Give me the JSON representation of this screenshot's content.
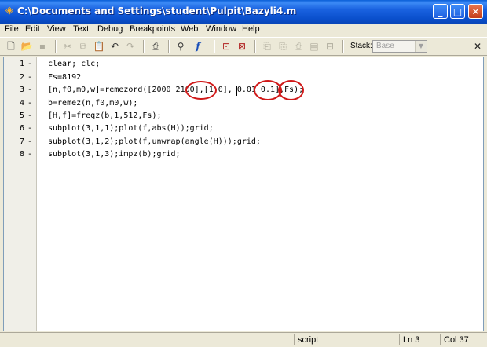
{
  "window": {
    "title": "C:\\Documents and Settings\\student\\Pulpit\\Bazyli4.m",
    "app_icon": "matlab-logo-icon",
    "minimize_glyph": "_",
    "maximize_glyph": "□",
    "close_glyph": "✕"
  },
  "menu": [
    "File",
    "Edit",
    "View",
    "Text",
    "Debug",
    "Breakpoints",
    "Web",
    "Window",
    "Help"
  ],
  "toolbar": {
    "icons": [
      "new-file-icon",
      "open-folder-icon",
      "save-icon",
      "cut-icon",
      "copy-icon",
      "paste-icon",
      "undo-icon",
      "redo-icon",
      "print-icon",
      "find-binoculars-icon",
      "function-icon",
      "set-breakpoint-icon",
      "clear-breakpoints-icon",
      "step-icon",
      "step-in-icon",
      "step-out-icon",
      "continue-icon",
      "exit-debug-icon"
    ],
    "stack_label": "Stack:",
    "stack_value": "Base",
    "doc_close_glyph": "✕"
  },
  "editor": {
    "lines": [
      {
        "num": "1",
        "text": "clear; clc;"
      },
      {
        "num": "2",
        "text": "Fs=8192"
      },
      {
        "num": "3",
        "text": "[n,f0,m0,w]=remezord([2000 2100],[1 0], 0.01 0.1],Fs);"
      },
      {
        "num": "4",
        "text": "b=remez(n,f0,m0,w);"
      },
      {
        "num": "5",
        "text": "[H,f]=freqz(b,1,512,Fs);"
      },
      {
        "num": "6",
        "text": "subplot(3,1,1);plot(f,abs(H));grid;"
      },
      {
        "num": "7",
        "text": "subplot(3,1,2);plot(f,unwrap(angle(H)));grid;"
      },
      {
        "num": "8",
        "text": "subplot(3,1,3);impz(b);grid;"
      }
    ],
    "dash": "-"
  },
  "status": {
    "mode": "script",
    "line": "Ln 3",
    "column": "Col 37"
  },
  "colors": {
    "titlebar": "#0a4fcc",
    "annotation": "#d01818"
  }
}
